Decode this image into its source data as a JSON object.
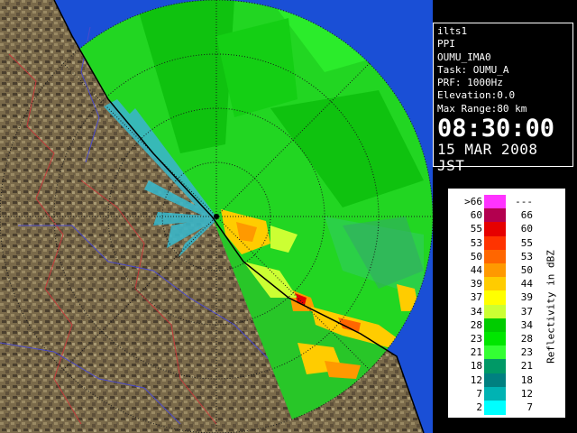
{
  "radar_view": {
    "description_icon": "radar-ppi-map"
  },
  "info": {
    "station": "ilts1",
    "product": "PPI",
    "scan_name": "OUMU_IMA0",
    "task": "Task: OUMU_A",
    "prf": "PRF: 1000Hz",
    "elevation": "Elevation:0.0",
    "max_range": "Max Range:80 km",
    "time": "08:30:00",
    "date": "15 MAR 2008 JST"
  },
  "legend": {
    "title": "Reflectivity in dBZ",
    "rows": [
      {
        "lo": ">66",
        "hi": "---",
        "color": "#ff33ff"
      },
      {
        "lo": "60",
        "hi": "66",
        "color": "#b3004f"
      },
      {
        "lo": "55",
        "hi": "60",
        "color": "#e60000"
      },
      {
        "lo": "53",
        "hi": "55",
        "color": "#ff3300"
      },
      {
        "lo": "50",
        "hi": "53",
        "color": "#ff6600"
      },
      {
        "lo": "44",
        "hi": "50",
        "color": "#ff9900"
      },
      {
        "lo": "39",
        "hi": "44",
        "color": "#ffcc00"
      },
      {
        "lo": "37",
        "hi": "39",
        "color": "#ffff00"
      },
      {
        "lo": "34",
        "hi": "37",
        "color": "#ccff33"
      },
      {
        "lo": "28",
        "hi": "34",
        "color": "#00cc00"
      },
      {
        "lo": "23",
        "hi": "28",
        "color": "#00e600"
      },
      {
        "lo": "21",
        "hi": "23",
        "color": "#33ff33"
      },
      {
        "lo": "18",
        "hi": "21",
        "color": "#009966"
      },
      {
        "lo": "12",
        "hi": "18",
        "color": "#008080"
      },
      {
        "lo": "7",
        "hi": "12",
        "color": "#00b3b3"
      },
      {
        "lo": "2",
        "hi": "7",
        "color": "#00ffff"
      }
    ]
  }
}
